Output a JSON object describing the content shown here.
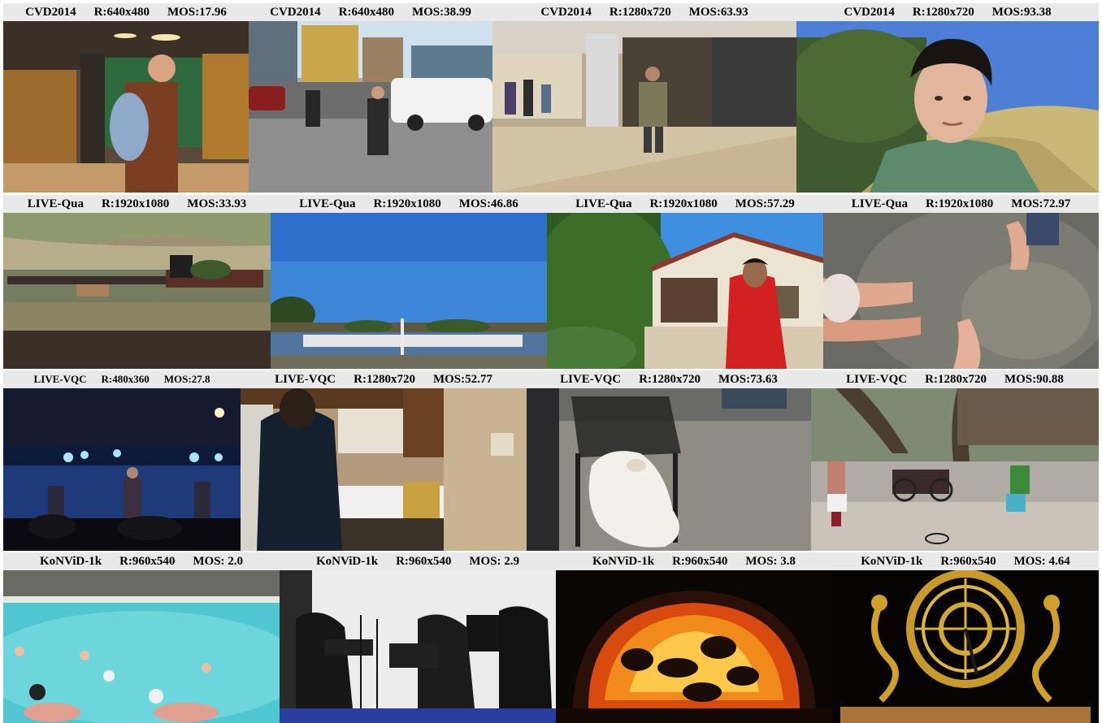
{
  "rows": [
    {
      "cells": [
        {
          "dataset": "CVD2014",
          "resolution": "R:640x480",
          "mos": "MOS:17.96",
          "scene": "person-with-backpack-in-corridor"
        },
        {
          "dataset": "CVD2014",
          "resolution": "R:640x480",
          "mos": "MOS:38.99",
          "scene": "city-street-with-van"
        },
        {
          "dataset": "CVD2014",
          "resolution": "R:1280x720",
          "mos": "MOS:63.93",
          "scene": "shopping-mall-walkway"
        },
        {
          "dataset": "CVD2014",
          "resolution": "R:1280x720",
          "mos": "MOS:93.38",
          "scene": "man-talking-outdoors"
        }
      ]
    },
    {
      "cells": [
        {
          "dataset": "LIVE-Qua",
          "resolution": "R:1920x1080",
          "mos": "MOS:33.93",
          "scene": "model-train-railway"
        },
        {
          "dataset": "LIVE-Qua",
          "resolution": "R:1920x1080",
          "mos": "MOS:46.86",
          "scene": "marina-with-boats"
        },
        {
          "dataset": "LIVE-Qua",
          "resolution": "R:1920x1080",
          "mos": "MOS:57.29",
          "scene": "man-in-red-shirt-at-mission"
        },
        {
          "dataset": "LIVE-Qua",
          "resolution": "R:1920x1080",
          "mos": "MOS:72.97",
          "scene": "hands-in-sand"
        }
      ]
    },
    {
      "cells": [
        {
          "dataset": "LIVE-VQC",
          "resolution": "R:480x360",
          "mos": "MOS:27.8",
          "scene": "band-on-stage"
        },
        {
          "dataset": "LIVE-VQC",
          "resolution": "R:1280x720",
          "mos": "MOS:52.77",
          "scene": "person-in-kitchen"
        },
        {
          "dataset": "LIVE-VQC",
          "resolution": "R:1280x720",
          "mos": "MOS:73.63",
          "scene": "white-dog-under-chair"
        },
        {
          "dataset": "LIVE-VQC",
          "resolution": "R:1280x720",
          "mos": "MOS:90.88",
          "scene": "street-drummers-in-plaza"
        }
      ]
    },
    {
      "cells": [
        {
          "dataset": "KoNViD-1k",
          "resolution": "R:960x540",
          "mos": "MOS: 2.0",
          "scene": "water-polo-pool"
        },
        {
          "dataset": "KoNViD-1k",
          "resolution": "R:960x540",
          "mos": "MOS: 2.9",
          "scene": "string-quartet-concert"
        },
        {
          "dataset": "KoNViD-1k",
          "resolution": "R:960x540",
          "mos": "MOS: 3.8",
          "scene": "fire-in-oven"
        },
        {
          "dataset": "KoNViD-1k",
          "resolution": "R:960x540",
          "mos": "MOS: 4.64",
          "scene": "golden-clock-mechanism"
        }
      ]
    }
  ]
}
